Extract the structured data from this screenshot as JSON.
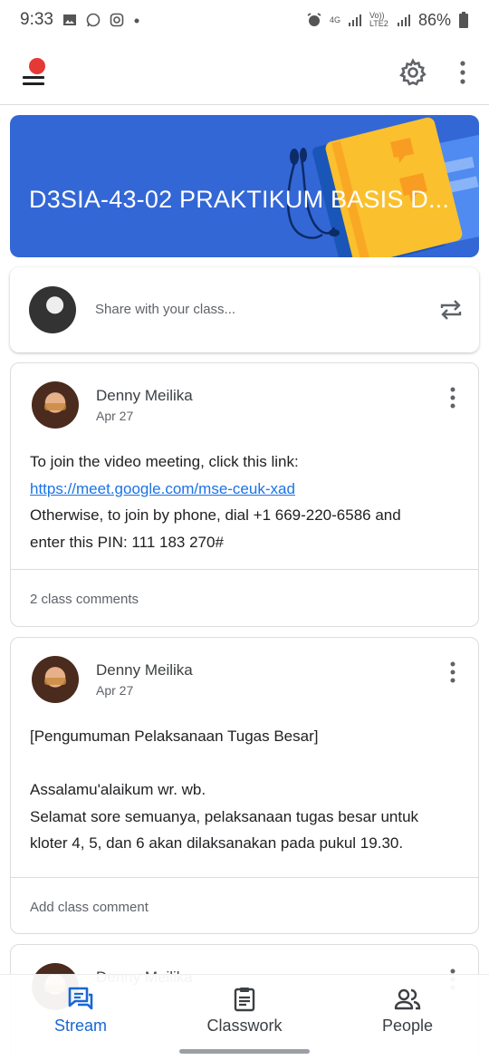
{
  "status_bar": {
    "time": "9:33",
    "network": "4G",
    "volte": "Vo)) LTE2",
    "battery": "86%",
    "icons": [
      "gallery-icon",
      "whatsapp-icon",
      "instagram-icon",
      "dot-icon",
      "alarm-icon",
      "signal-icon",
      "battery-icon"
    ]
  },
  "app_bar": {
    "icons": [
      "menu-icon",
      "notification-dot",
      "gear-icon",
      "more-vert-icon"
    ]
  },
  "banner": {
    "title": "D3SIA-43-02 PRAKTIKUM BASIS D...",
    "color": "#3367d6"
  },
  "share": {
    "placeholder": "Share with your class...",
    "icon": "repost-icon"
  },
  "posts": [
    {
      "author": "Denny Meilika",
      "date": "Apr 27",
      "line1": "To join the video meeting, click this link:",
      "link": "https://meet.google.com/mse-ceuk-xad",
      "line3": "Otherwise, to join by phone, dial +1 669-220-6586 and",
      "line4": "enter this PIN: 111 183 270#",
      "footer": "2 class comments"
    },
    {
      "author": "Denny Meilika",
      "date": "Apr 27",
      "line1": "[Pengumuman Pelaksanaan Tugas Besar]",
      "line3": "Assalamu'alaikum wr. wb.",
      "line4": "Selamat sore semuanya, pelaksanaan tugas besar untuk",
      "line5": "kloter 4, 5, dan 6 akan dilaksanakan pada pukul 19.30.",
      "footer": "Add class comment"
    },
    {
      "author": "Denny Meilika"
    }
  ],
  "bottom_nav": {
    "items": [
      {
        "label": "Stream",
        "icon": "stream-icon",
        "active": true
      },
      {
        "label": "Classwork",
        "icon": "classwork-icon",
        "active": false
      },
      {
        "label": "People",
        "icon": "people-icon",
        "active": false
      }
    ],
    "accent": "#1967d2"
  }
}
